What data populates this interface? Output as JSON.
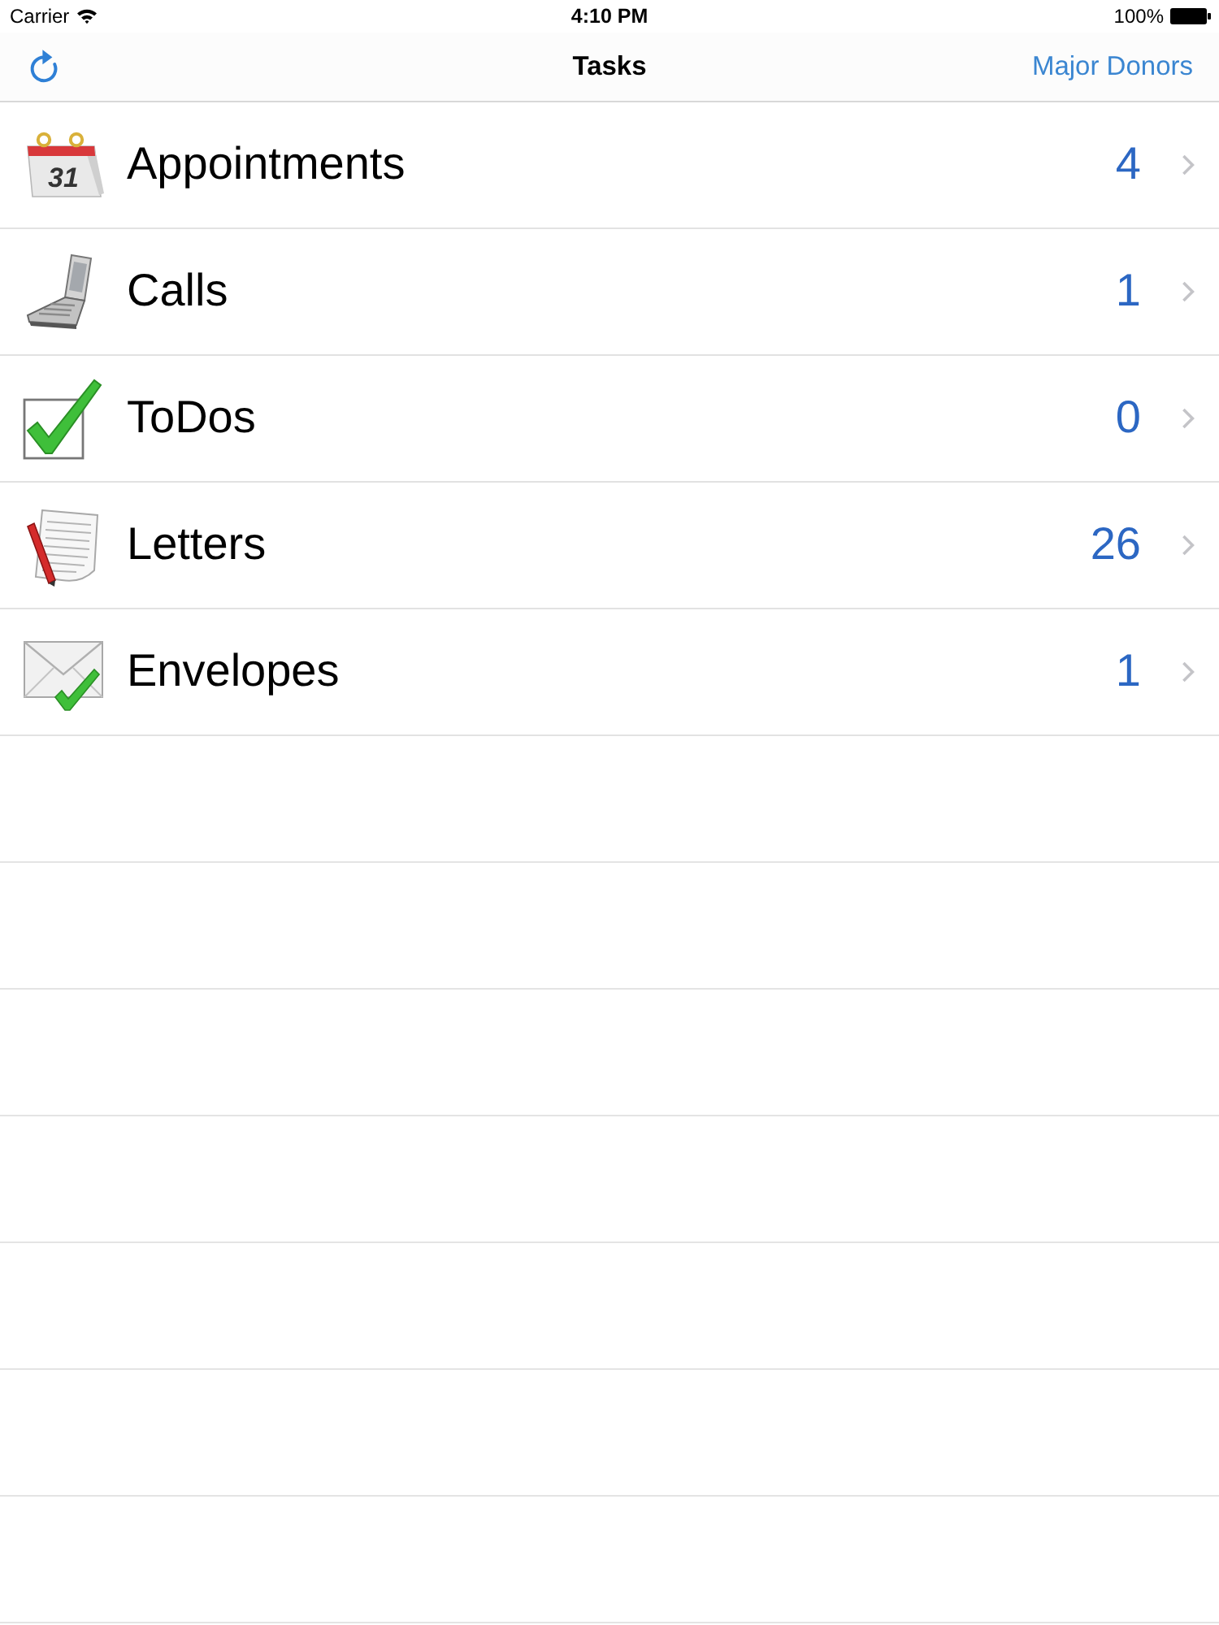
{
  "status_bar": {
    "carrier": "Carrier",
    "time": "4:10 PM",
    "battery": "100%"
  },
  "nav_bar": {
    "title": "Tasks",
    "right_button": "Major Donors"
  },
  "tasks": [
    {
      "kind": "calendar",
      "icon_text": "31",
      "label": "Appointments",
      "count": "4"
    },
    {
      "kind": "phone",
      "label": "Calls",
      "count": "1"
    },
    {
      "kind": "checkbox",
      "label": "ToDos",
      "count": "0"
    },
    {
      "kind": "letter",
      "label": "Letters",
      "count": "26"
    },
    {
      "kind": "envelope",
      "label": "Envelopes",
      "count": "1"
    }
  ]
}
